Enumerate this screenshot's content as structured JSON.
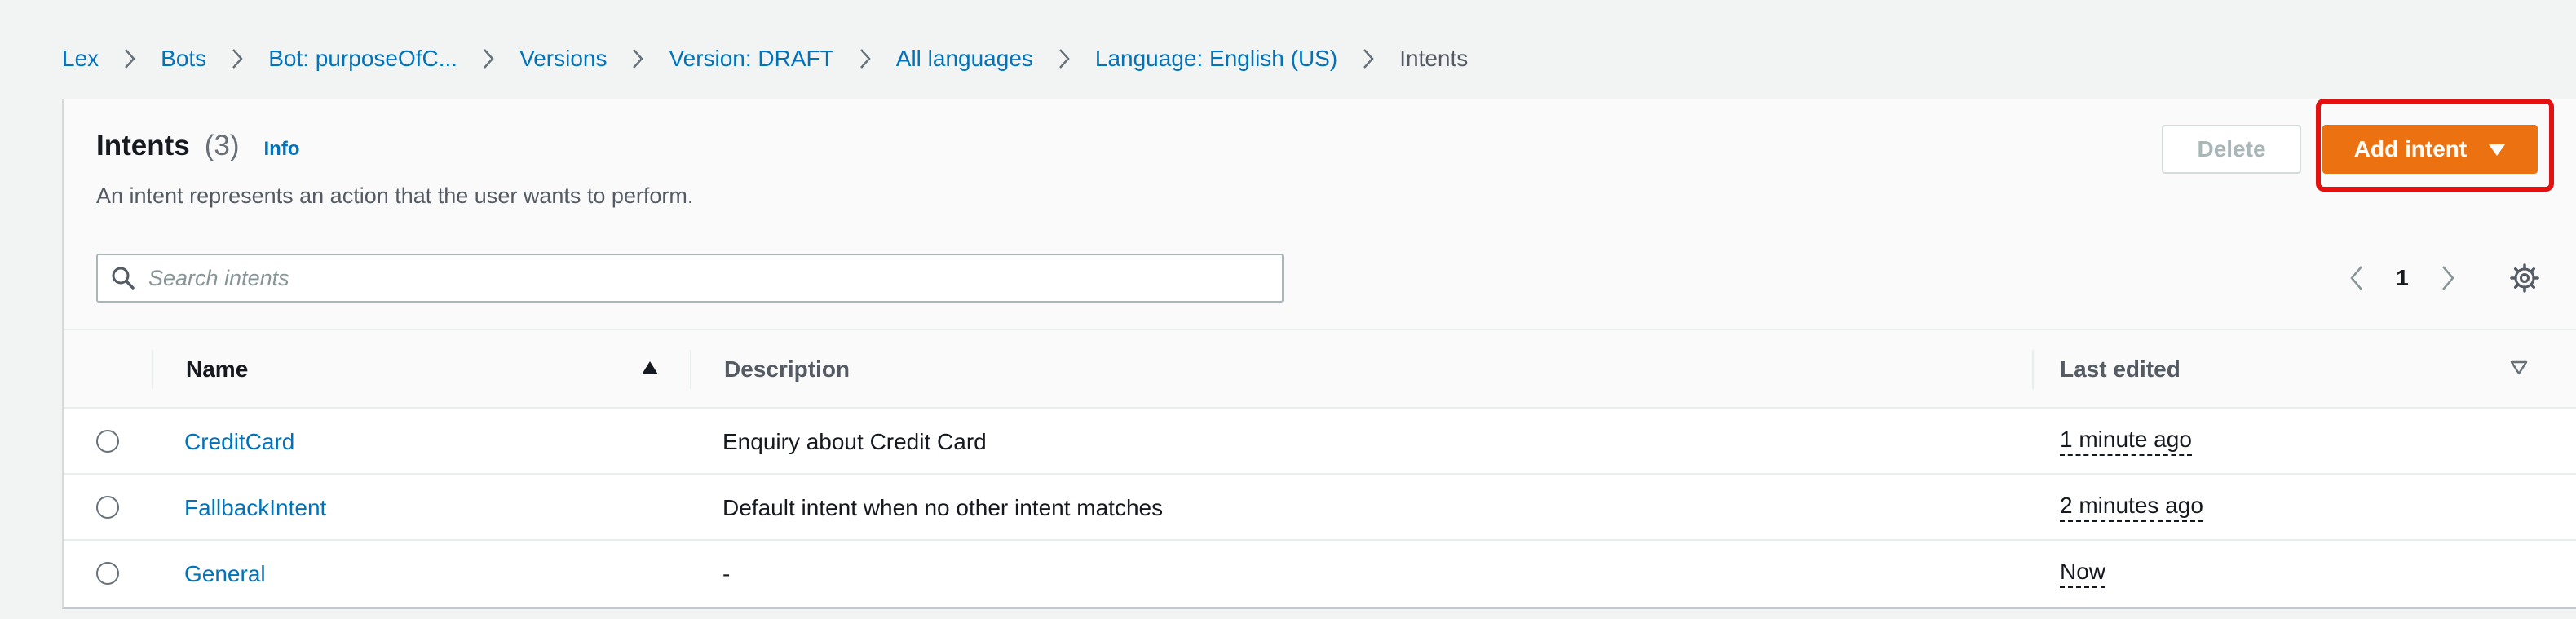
{
  "breadcrumb": [
    {
      "label": "Lex"
    },
    {
      "label": "Bots"
    },
    {
      "label": "Bot: purposeOfC..."
    },
    {
      "label": "Versions"
    },
    {
      "label": "Version: DRAFT"
    },
    {
      "label": "All languages"
    },
    {
      "label": "Language: English (US)"
    },
    {
      "label": "Intents"
    }
  ],
  "header": {
    "title": "Intents",
    "count": "(3)",
    "info": "Info",
    "description": "An intent represents an action that the user wants to perform."
  },
  "actions": {
    "delete_label": "Delete",
    "add_label": "Add intent"
  },
  "search": {
    "placeholder": "Search intents",
    "value": ""
  },
  "pagination": {
    "current_page": "1"
  },
  "table": {
    "columns": {
      "name": "Name",
      "description": "Description",
      "last_edited": "Last edited"
    },
    "rows": [
      {
        "name": "CreditCard",
        "description": "Enquiry about Credit Card",
        "last_edited": "1 minute ago"
      },
      {
        "name": "FallbackIntent",
        "description": "Default intent when no other intent matches",
        "last_edited": "2 minutes ago"
      },
      {
        "name": "General",
        "description": "-",
        "last_edited": "Now"
      }
    ]
  },
  "colors": {
    "link": "#0073bb",
    "primary_button": "#ec7211",
    "highlight": "#e41111"
  }
}
